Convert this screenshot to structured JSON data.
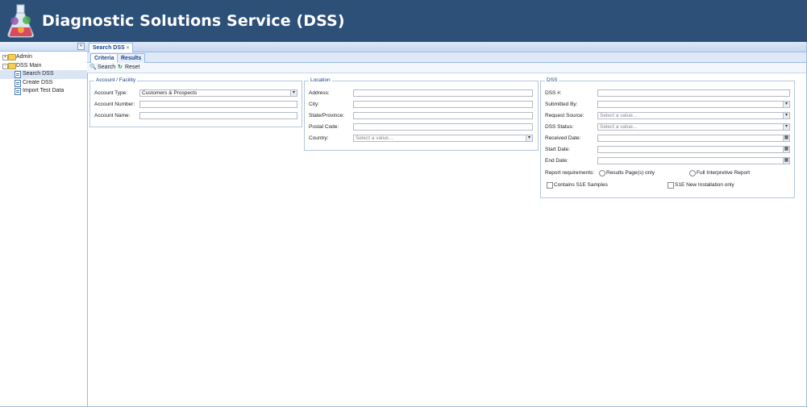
{
  "app": {
    "title": "Diagnostic Solutions Service (DSS)"
  },
  "sidebar": {
    "collapse_icon": "«",
    "items": [
      {
        "label": "Admin",
        "expander": "+"
      },
      {
        "label": "DSS Main",
        "expander": "-"
      },
      {
        "label": "Search DSS"
      },
      {
        "label": "Create DSS"
      },
      {
        "label": "Import Test Data"
      }
    ]
  },
  "tabs": {
    "main_tab": "Search DSS",
    "main_tab_close": "×"
  },
  "subtabs": {
    "criteria": "Criteria",
    "results": "Results"
  },
  "toolbar": {
    "search": "Search",
    "reset": "Reset",
    "search_icon": "🔍",
    "reset_icon": "↻"
  },
  "account": {
    "legend": "Account / Facility",
    "account_type_label": "Account Type:",
    "account_type_value": "Customers & Prospects",
    "account_number_label": "Account Number:",
    "account_name_label": "Account Name:"
  },
  "location": {
    "legend": "Location",
    "address_label": "Address:",
    "city_label": "City:",
    "state_label": "State/Province:",
    "postal_label": "Postal Code:",
    "country_label": "Country:",
    "country_placeholder": "Select a value..."
  },
  "dss": {
    "legend": "DSS",
    "number_label": "DSS #:",
    "submitted_by_label": "Submitted By:",
    "request_source_label": "Request Source:",
    "request_source_placeholder": "Select a value...",
    "status_label": "DSS Status:",
    "status_placeholder": "Select a value...",
    "received_label": "Received Date:",
    "start_label": "Start Date:",
    "end_label": "End Date:",
    "report_req_label": "Report requirements:",
    "results_only_label": "Results Page(s) only",
    "full_report_label": "Full Interpretive Report",
    "contains_s1e_label": "Contains S1E Samples",
    "s1e_new_label": "S1E New Installation only"
  },
  "icons": {
    "dropdown": "▾",
    "calendar": "▦"
  },
  "colors": {
    "header_bg": "#2d5079",
    "accent": "#15428b",
    "border": "#99bbe8"
  }
}
